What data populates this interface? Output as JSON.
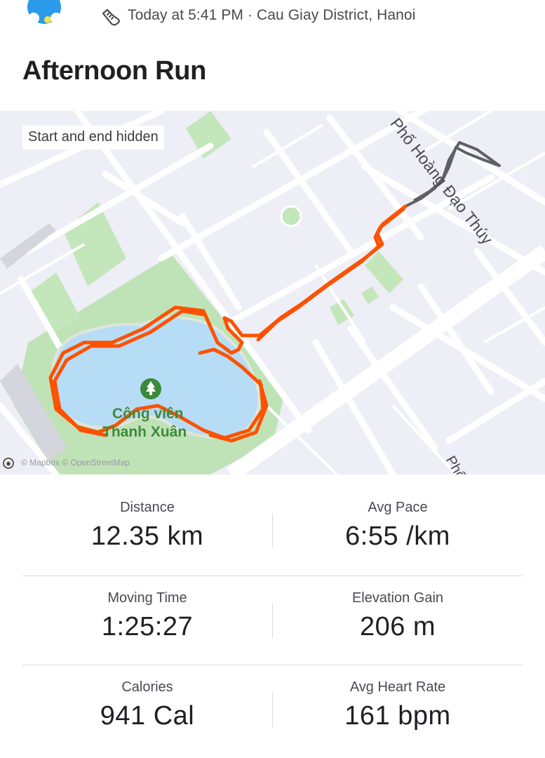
{
  "header": {
    "meta": "Today at 5:41 PM · Cau Giay District, Hanoi",
    "title": "Afternoon Run"
  },
  "map": {
    "privacy_badge": "Start and end hidden",
    "attribution": "© Mapbox © OpenStreetMap",
    "street_label_1": "Phố Hoàng Đạo Thúy",
    "street_label_2": "Phố",
    "park_label_line1": "Công viên",
    "park_label_line2": "Thanh Xuân",
    "route_color": "#fc5200",
    "hidden_route_color": "#5f5f66",
    "water_color": "#b7dcf5",
    "park_color": "#b9e0b0"
  },
  "stats": [
    {
      "label": "Distance",
      "value": "12.35 km"
    },
    {
      "label": "Avg Pace",
      "value": "6:55 /km"
    },
    {
      "label": "Moving Time",
      "value": "1:25:27"
    },
    {
      "label": "Elevation Gain",
      "value": "206 m"
    },
    {
      "label": "Calories",
      "value": "941 Cal"
    },
    {
      "label": "Avg Heart Rate",
      "value": "161 bpm"
    }
  ]
}
